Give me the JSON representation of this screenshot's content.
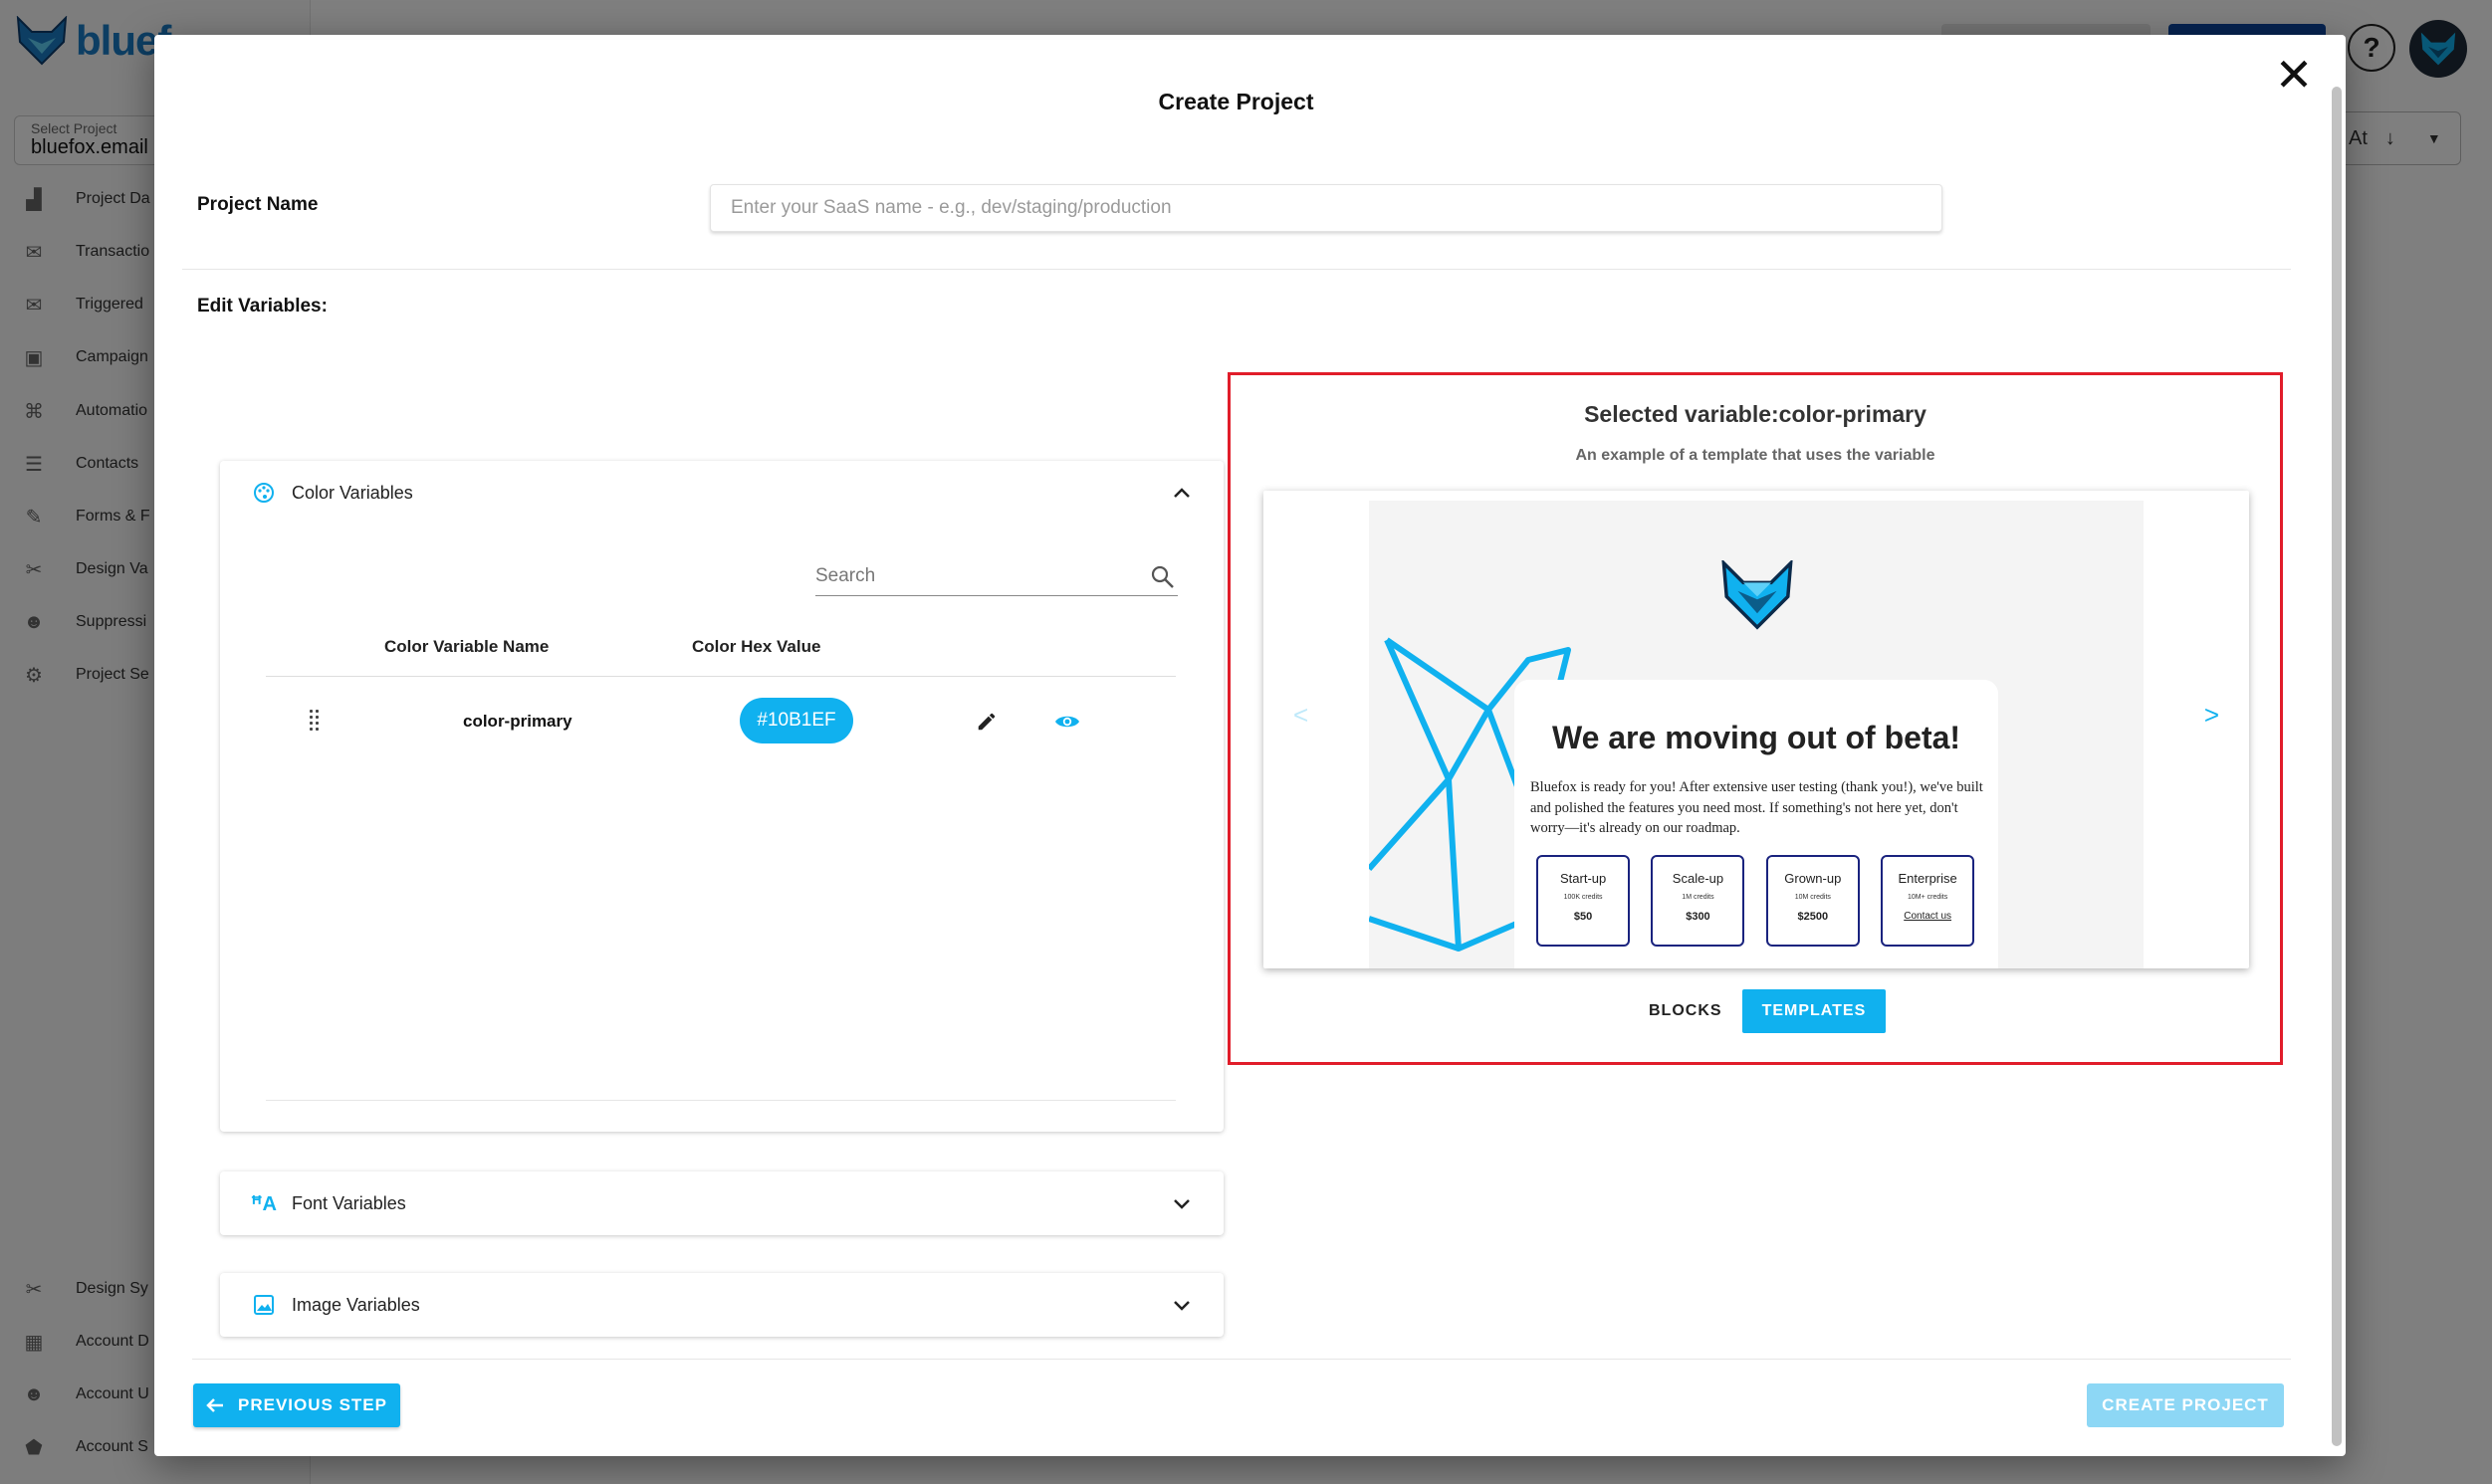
{
  "background": {
    "logo_text": "bluef",
    "project_select": {
      "label": "Select Project",
      "value": "bluefox.email"
    },
    "nav_items": [
      {
        "label": "Project Da",
        "icon": "chart-icon"
      },
      {
        "label": "Transactio",
        "icon": "mail-list-icon"
      },
      {
        "label": "Triggered",
        "icon": "mail-icon"
      },
      {
        "label": "Campaign",
        "icon": "briefcase-icon"
      },
      {
        "label": "Automatio",
        "icon": "sitemap-icon"
      },
      {
        "label": "Contacts",
        "icon": "contacts-icon"
      },
      {
        "label": "Forms & F",
        "icon": "form-icon"
      },
      {
        "label": "Design Va",
        "icon": "tools-icon"
      },
      {
        "label": "Suppressi",
        "icon": "people-icon"
      },
      {
        "label": "Project Se",
        "icon": "gear-icon"
      }
    ],
    "bottom_nav_items": [
      {
        "label": "Design Sy",
        "icon": "tools-icon"
      },
      {
        "label": "Account D",
        "icon": "dashboard-icon"
      },
      {
        "label": "Account U",
        "icon": "people-icon"
      },
      {
        "label": "Account S",
        "icon": "settings-logo-icon"
      }
    ],
    "sort_label": "At",
    "help_label": "?"
  },
  "modal": {
    "title": "Create Project",
    "project_name_label": "Project Name",
    "project_name_placeholder": "Enter your SaaS name - e.g., dev/staging/production",
    "project_name_value": "",
    "edit_variables_label": "Edit Variables:",
    "color_panel": {
      "label": "Color Variables",
      "search_placeholder": "Search",
      "columns": [
        "Color Variable Name",
        "Color Hex Value"
      ],
      "rows": [
        {
          "name": "color-primary",
          "hex": "#10B1EF"
        }
      ]
    },
    "font_panel": {
      "label": "Font Variables"
    },
    "image_panel": {
      "label": "Image Variables"
    },
    "preview": {
      "title": "Selected variable:color-primary",
      "subtitle": "An example of a template that uses the variable",
      "prev_arrow": "<",
      "next_arrow": ">",
      "email": {
        "heading": "We are moving out of beta!",
        "body": "Bluefox is ready for you! After extensive user testing (thank you!), we've built and polished the features you need most. If something's not here yet, don't worry—it's already on our roadmap.",
        "plans": [
          {
            "name": "Start-up",
            "credits": "100K credits",
            "price": "$50"
          },
          {
            "name": "Scale-up",
            "credits": "1M credits",
            "price": "$300"
          },
          {
            "name": "Grown-up",
            "credits": "10M credits",
            "price": "$2500"
          },
          {
            "name": "Enterprise",
            "credits": "10M+ credits",
            "price": "Contact us"
          }
        ]
      },
      "tabs": [
        "BLOCKS",
        "TEMPLATES"
      ],
      "active_tab": "TEMPLATES"
    },
    "previous_step_label": "PREVIOUS STEP",
    "create_project_label": "CREATE PROJECT"
  },
  "colors": {
    "accent": "#10B1EF",
    "highlight_border": "#E11D2A",
    "brand_dark": "#1A237E"
  }
}
